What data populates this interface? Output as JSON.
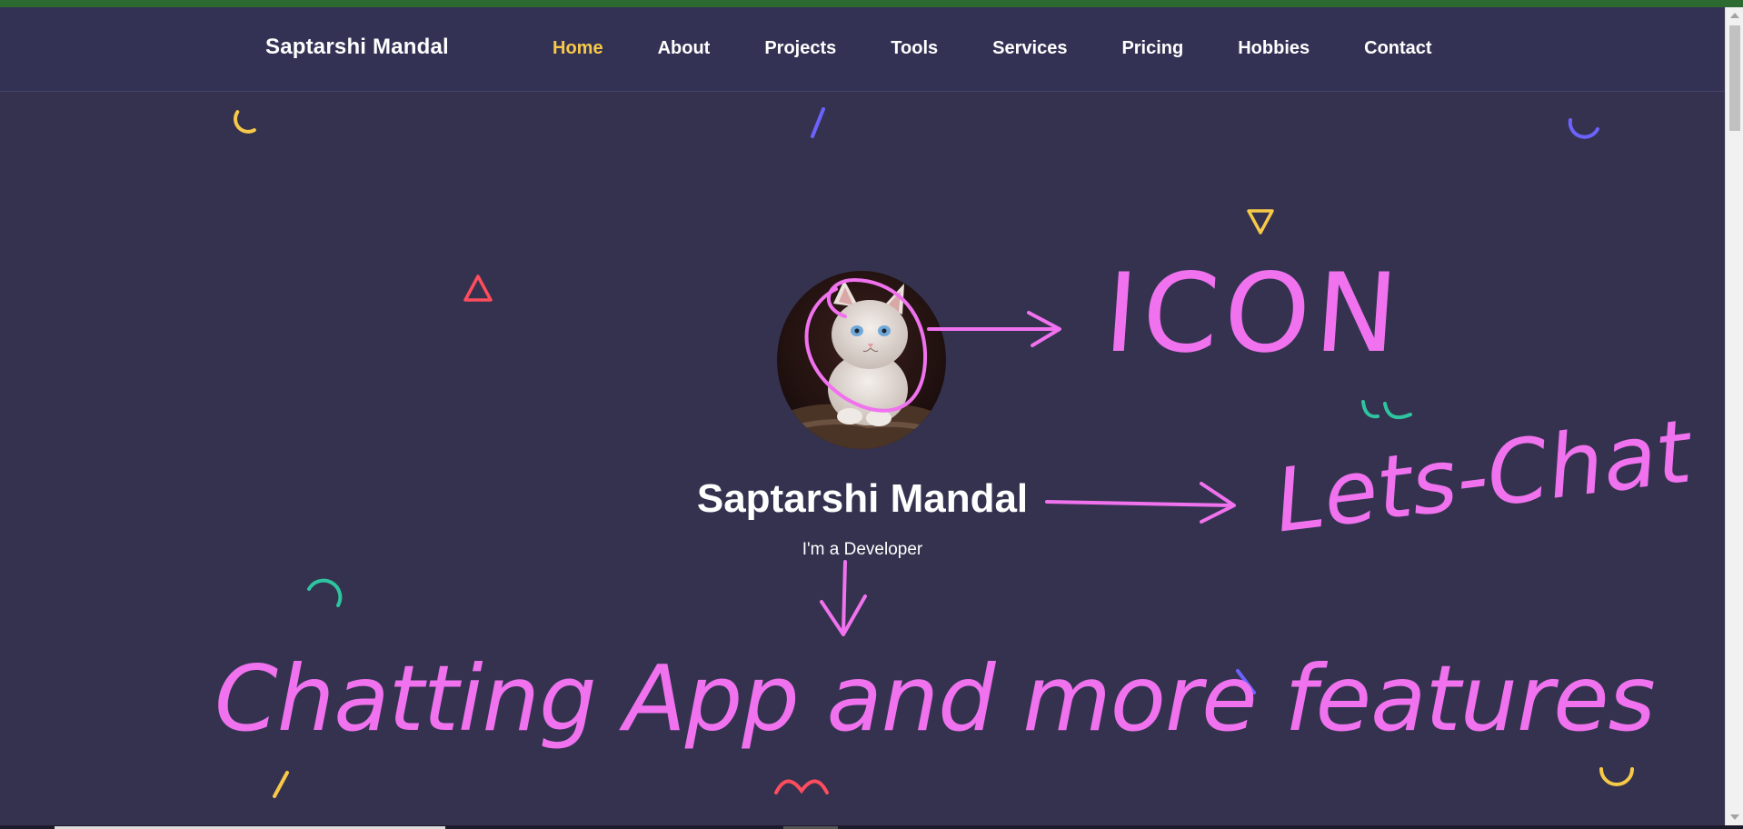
{
  "brand": {
    "name": "Saptarshi Mandal"
  },
  "nav": {
    "items": [
      {
        "label": "Home",
        "active": true
      },
      {
        "label": "About",
        "active": false
      },
      {
        "label": "Projects",
        "active": false
      },
      {
        "label": "Tools",
        "active": false
      },
      {
        "label": "Services",
        "active": false
      },
      {
        "label": "Pricing",
        "active": false
      },
      {
        "label": "Hobbies",
        "active": false
      },
      {
        "label": "Contact",
        "active": false
      }
    ]
  },
  "hero": {
    "avatar_icon": "kitten-photo",
    "name": "Saptarshi Mandal",
    "role": "I'm a Developer"
  },
  "annotations": {
    "icon_note": "ICON",
    "chat_note": "Lets-Chat",
    "feature_note": "Chatting App and more features"
  },
  "colors": {
    "background": "#343254",
    "accent_active": "#f7c948",
    "annotation": "#f072ee",
    "topbar": "#2d6a32"
  }
}
